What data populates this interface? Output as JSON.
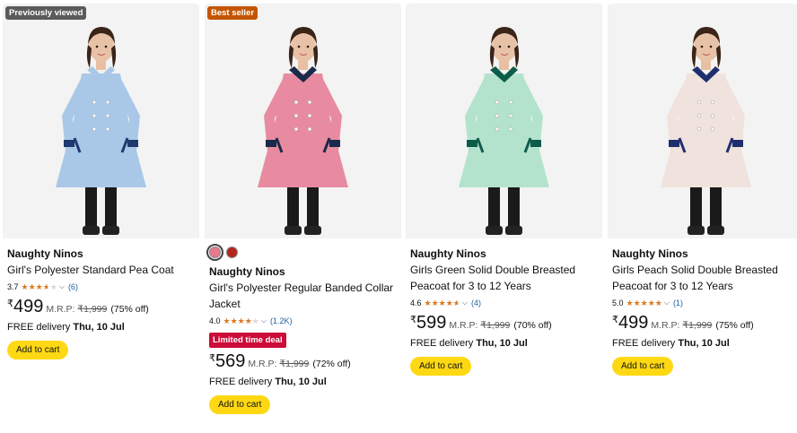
{
  "colors": {
    "accent_button": "#ffd814",
    "deal_badge": "#cc0c39",
    "best_seller": "#c45500",
    "star": "#de7921",
    "link": "#2162a1"
  },
  "products": [
    {
      "badge": "Previously viewed",
      "swatches": [],
      "brand": "Naughty Ninos",
      "title": "Girl's Polyester Standard Pea Coat",
      "rating_value": "3.7",
      "rating_stars": 3.7,
      "rating_count": "(6)",
      "currency": "₹",
      "price": "499",
      "mrp_label": "M.R.P:",
      "mrp_value": "₹1,999",
      "discount": "(75% off)",
      "deal_label": "",
      "delivery_prefix": "FREE delivery",
      "delivery_date": "Thu, 10 Jul",
      "cart_label": "Add to cart",
      "coat_color": "#a9c8e8"
    },
    {
      "badge": "Best seller",
      "swatches": [
        {
          "color": "#e8788f",
          "selected": true
        },
        {
          "color": "#b3261e",
          "selected": false
        }
      ],
      "brand": "Naughty Ninos",
      "title": "Girl's Polyester Regular Banded Collar Jacket",
      "rating_value": "4.0",
      "rating_stars": 4.0,
      "rating_count": "(1.2K)",
      "currency": "₹",
      "price": "569",
      "mrp_label": "M.R.P:",
      "mrp_value": "₹1,999",
      "discount": "(72% off)",
      "deal_label": "Limited time deal",
      "delivery_prefix": "FREE delivery",
      "delivery_date": "Thu, 10 Jul",
      "cart_label": "Add to cart",
      "coat_color": "#e88ba0"
    },
    {
      "badge": "",
      "swatches": [],
      "brand": "Naughty Ninos",
      "title": "Girls Green Solid Double Breasted Peacoat for 3 to 12 Years",
      "rating_value": "4.6",
      "rating_stars": 4.6,
      "rating_count": "(4)",
      "currency": "₹",
      "price": "599",
      "mrp_label": "M.R.P:",
      "mrp_value": "₹1,999",
      "discount": "(70% off)",
      "deal_label": "",
      "delivery_prefix": "FREE delivery",
      "delivery_date": "Thu, 10 Jul",
      "cart_label": "Add to cart",
      "coat_color": "#b3e3cc"
    },
    {
      "badge": "",
      "swatches": [],
      "brand": "Naughty Ninos",
      "title": "Girls Peach Solid Double Breasted Peacoat for 3 to 12 Years",
      "rating_value": "5.0",
      "rating_stars": 5.0,
      "rating_count": "(1)",
      "currency": "₹",
      "price": "499",
      "mrp_label": "M.R.P:",
      "mrp_value": "₹1,999",
      "discount": "(75% off)",
      "deal_label": "",
      "delivery_prefix": "FREE delivery",
      "delivery_date": "Thu, 10 Jul",
      "cart_label": "Add to cart",
      "coat_color": "#f0e2dc"
    }
  ]
}
